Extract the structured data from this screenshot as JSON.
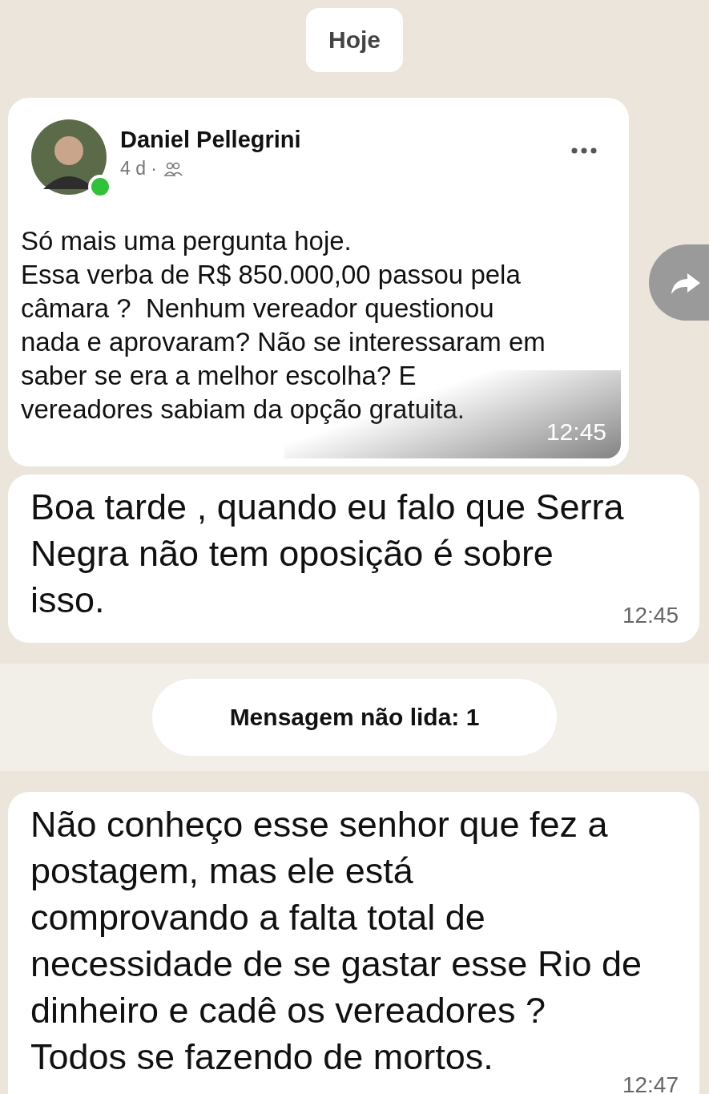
{
  "date_pill": "Hoje",
  "messages": [
    {
      "kind": "post",
      "author": "Daniel Pellegrini",
      "age": "4 d ·",
      "online": true,
      "text": "Só mais uma pergunta hoje.\nEssa verba de R$ 850.000,00 passou pela\ncâmara ?  Nenhum vereador questionou\nnada e aprovaram? Não se interessaram em\nsaber se era a melhor escolha? E\nvereadores sabiam da opção gratuita.",
      "time": "12:45",
      "forward": true
    },
    {
      "kind": "text",
      "text": "Boa tarde , quando eu falo que Serra\nNegra não tem oposição é sobre\nisso.",
      "time": "12:45"
    },
    {
      "kind": "unread",
      "label": "Mensagem não lida: 1"
    },
    {
      "kind": "text",
      "text": "Não conheço esse senhor que fez a\npostagem, mas ele está\ncomprovando a falta total de\nnecessidade de se gastar esse Rio de\ndinheiro e cadê os vereadores ?\nTodos se fazendo de mortos.",
      "time": "12:47"
    }
  ]
}
